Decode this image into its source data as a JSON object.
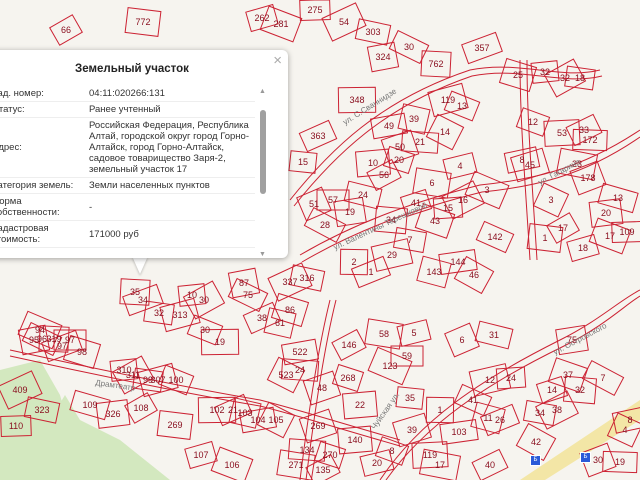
{
  "popup": {
    "title": "Земельный участок",
    "close_icon": "×",
    "rows": [
      {
        "label": "Кад. номер:",
        "value": "04:11:020266:131"
      },
      {
        "label": "Статус:",
        "value": "Ранее учтенный"
      },
      {
        "label": "Адрес:",
        "value": "Российская Федерация, Республика Алтай, городской округ город Горно-Алтайск, город Горно-Алтайск, садовое товарищество Заря-2, земельный участок 17"
      },
      {
        "label": "Категория земель:",
        "value": "Земли населенных пунктов"
      },
      {
        "label": "Форма собственности:",
        "value": "-"
      },
      {
        "label": "Кадастровая стоимость:",
        "value": "171000 руб"
      }
    ]
  },
  "streets": [
    "ул. С.Сваннидзе",
    "ул. Валентины Терешковой",
    "ул. Гагарина",
    "ул. Островского",
    "Чуйская ул.",
    "Драмтеатр"
  ],
  "parcels": [
    "66",
    "772",
    "262",
    "281",
    "275",
    "54",
    "303",
    "324",
    "30",
    "762",
    "357",
    "25",
    "32",
    "32",
    "18",
    "119",
    "13",
    "348",
    "363",
    "39",
    "49",
    "14",
    "21",
    "50",
    "20",
    "10",
    "56",
    "6",
    "4",
    "3",
    "57",
    "51",
    "24",
    "19",
    "28",
    "34",
    "41",
    "43",
    "15",
    "16",
    "7",
    "29",
    "142",
    "2",
    "1",
    "143",
    "144",
    "46",
    "15",
    "45",
    "12",
    "53",
    "33",
    "23",
    "8",
    "3",
    "172",
    "178",
    "13",
    "20",
    "17",
    "1",
    "18",
    "17",
    "109",
    "337",
    "316",
    "87",
    "75",
    "35",
    "34",
    "86",
    "10",
    "30",
    "32",
    "313",
    "30",
    "19",
    "38",
    "61",
    "522",
    "523",
    "24",
    "48",
    "268",
    "22",
    "146",
    "58",
    "5",
    "123",
    "59",
    "6",
    "31",
    "75",
    "7",
    "32",
    "14",
    "37",
    "24",
    "38",
    "34",
    "12",
    "41",
    "1",
    "26",
    "11",
    "103",
    "42",
    "35",
    "39",
    "8",
    "119",
    "40",
    "17",
    "8",
    "4",
    "19",
    "30",
    "109",
    "326",
    "108",
    "269",
    "107",
    "106",
    "110",
    "409",
    "323",
    "95",
    "96",
    "319",
    "97",
    "98",
    "310",
    "311",
    "99",
    "307",
    "100",
    "102",
    "21",
    "103",
    "104",
    "105",
    "134",
    "269",
    "270",
    "140",
    "135",
    "271",
    "20",
    "94",
    "97"
  ],
  "colors": {
    "parcel": "#cc2233",
    "background": "#f6f4ef",
    "green": "#cfe6b8",
    "road": "#f2e3a0"
  },
  "bus_stop_icon": "Б"
}
